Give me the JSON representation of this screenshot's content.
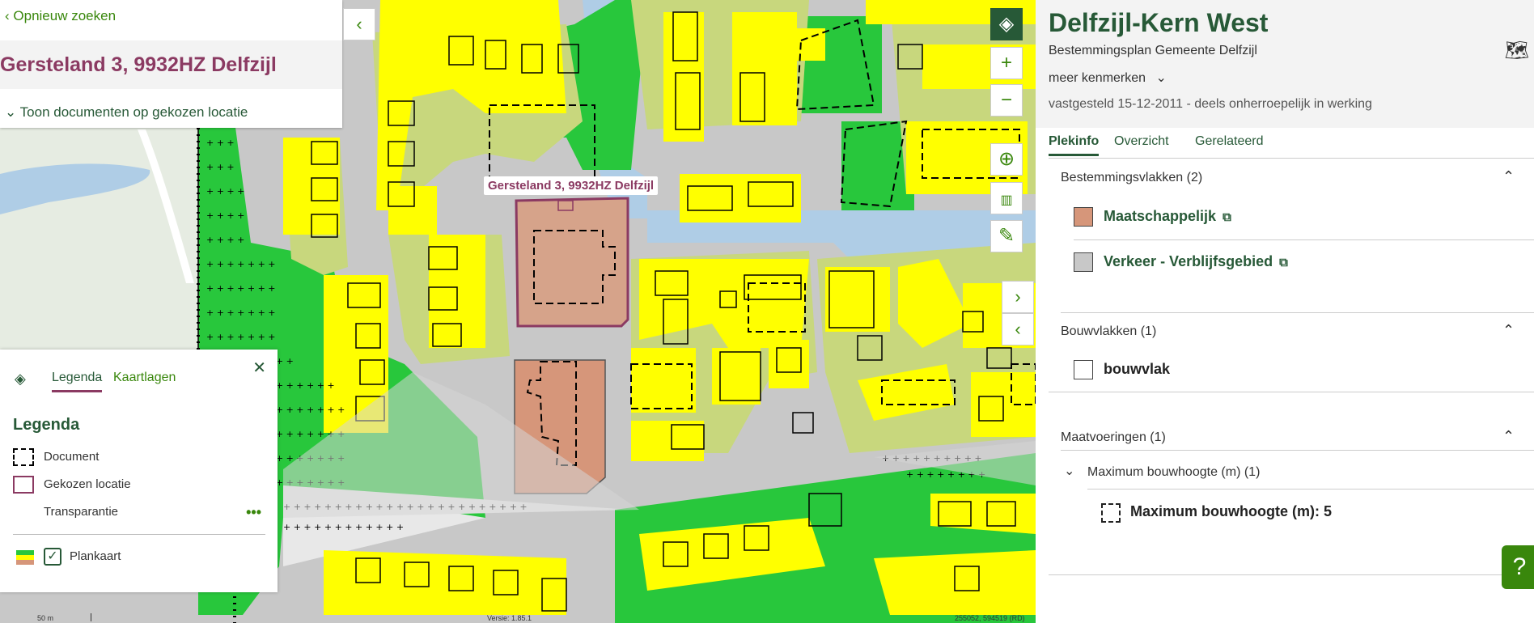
{
  "search_panel": {
    "back_label": "Opnieuw zoeken",
    "address": "Gersteland 3, 9932HZ Delfzijl",
    "documents_link": "Toon documenten op gekozen locatie"
  },
  "map": {
    "location_label": "Gersteland 3, 9932HZ Delfzijl",
    "tools": [
      "layers-icon",
      "zoom-in-icon",
      "zoom-out-icon",
      "locate-icon",
      "measure-icon",
      "draw-icon"
    ],
    "colors": {
      "wonen": "#ffff00",
      "groen": "#28c73c",
      "water": "#afcde6",
      "verkeer": "#c8c8c8",
      "maatschappelijk": "#d6967a",
      "tuin": "#c8d77d"
    }
  },
  "legend_panel": {
    "tabs": [
      "Legenda",
      "Kaartlagen"
    ],
    "heading": "Legenda",
    "rows": [
      "Document",
      "Gekozen locatie",
      "Transparantie",
      "Plankaart"
    ],
    "plankaart_checked": true
  },
  "footer": {
    "scale": "50 m",
    "version": "Versie: 1.85.1",
    "coordinates": "255052, 594519 (RD)"
  },
  "plan_panel": {
    "title": "Delfzijl-Kern West",
    "subtitle": "Bestemmingsplan  Gemeente Delfzijl",
    "meer_kenmerken": "meer kenmerken",
    "status": "vastgesteld 15-12-2011 - deels onherroepelijk in werking",
    "tabs": [
      "Plekinfo",
      "Overzicht",
      "Gerelateerd"
    ],
    "sections": {
      "bestemmingsvlakken": "Bestemmingsvlakken (2)",
      "bestemmingsvlakken_items": [
        "Maatschappelijk",
        "Verkeer - Verblijfsgebied"
      ],
      "bouwvlakken": "Bouwvlakken (1)",
      "bouwvlakken_items": [
        "bouwvlak"
      ],
      "maatvoeringen": "Maatvoeringen (1)",
      "maatvoeringen_sub": "Maximum bouwhoogte (m) (1)",
      "maatvoeringen_items": [
        "Maximum bouwhoogte (m): 5"
      ]
    }
  },
  "help_label": "?"
}
